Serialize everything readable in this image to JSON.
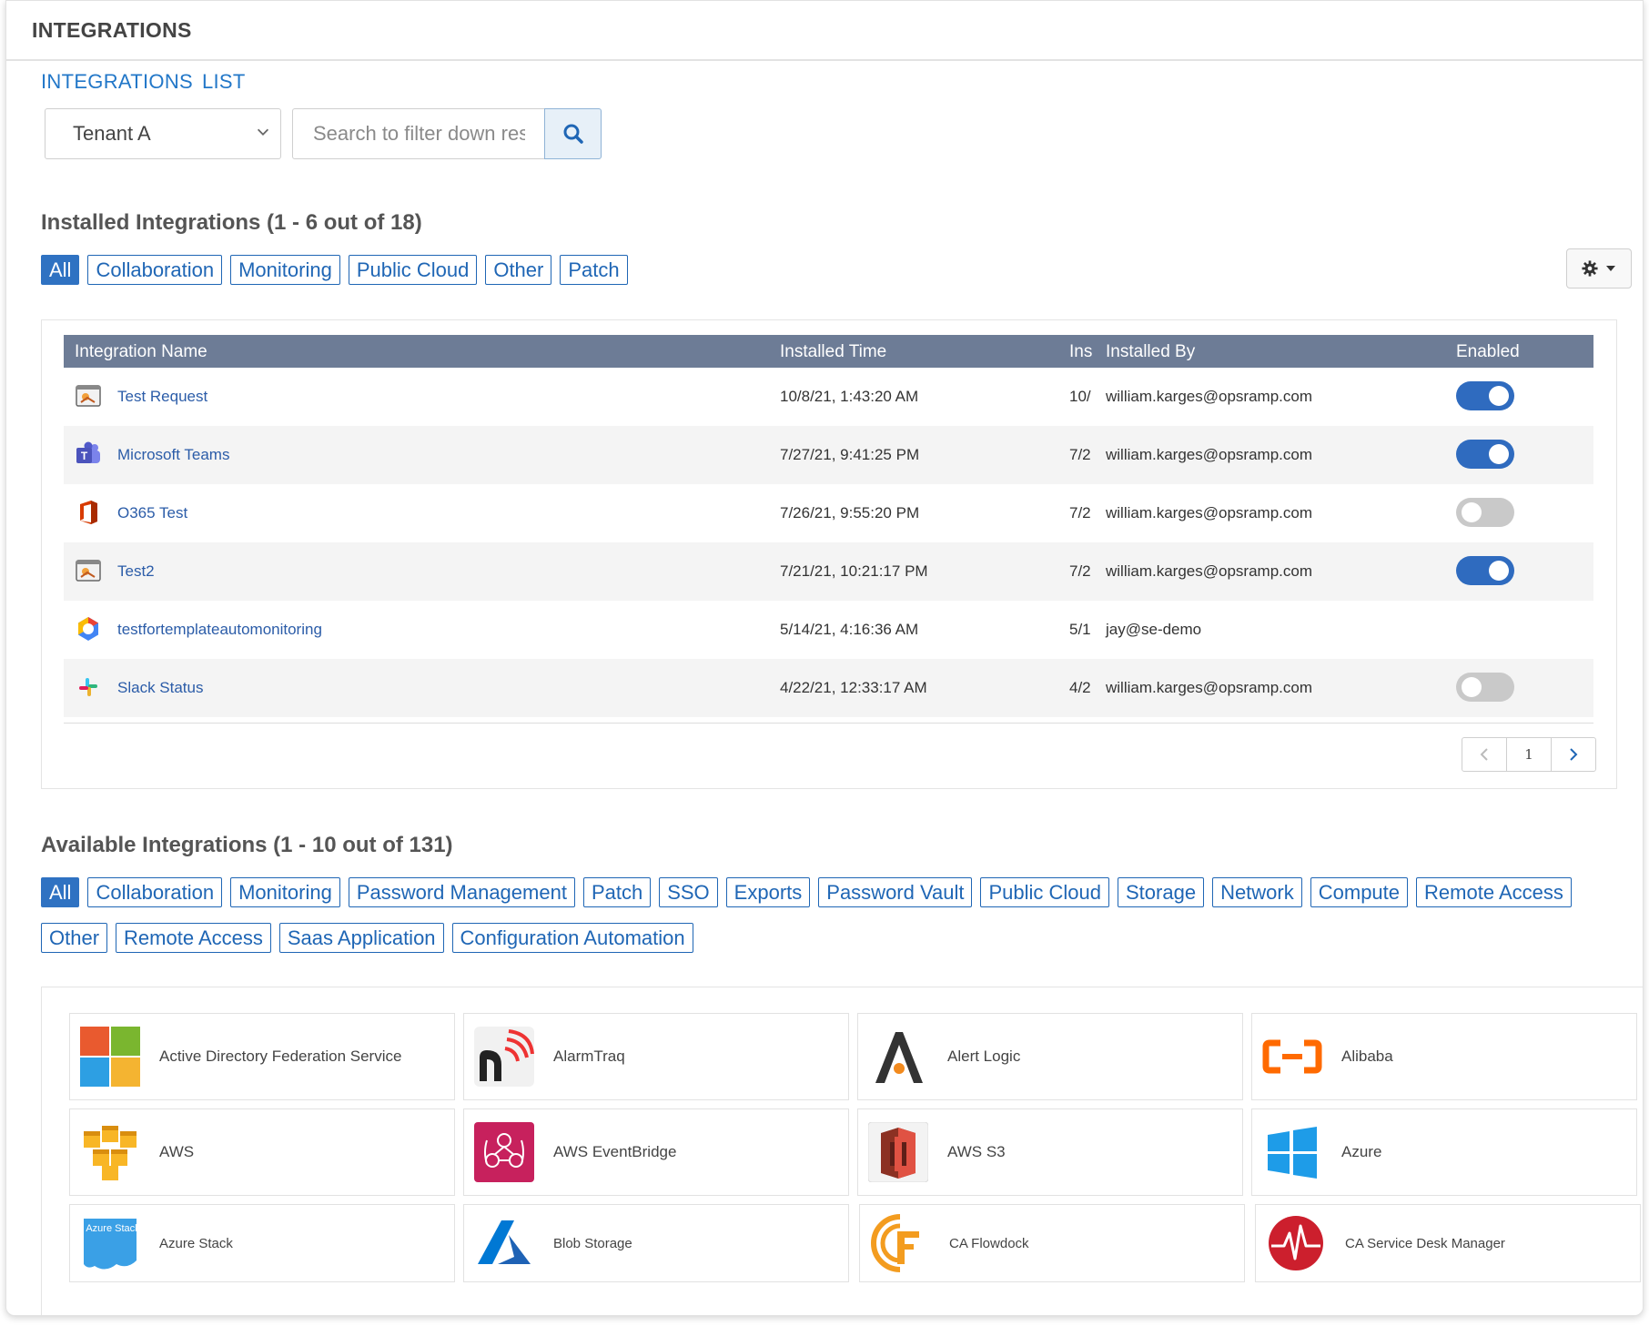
{
  "header": {
    "title": "INTEGRATIONS"
  },
  "breadcrumb": [
    "INTEGRATIONS",
    "LIST"
  ],
  "tenant": {
    "selected": "Tenant A"
  },
  "search": {
    "placeholder": "Search to filter down results"
  },
  "installed": {
    "title": "Installed Integrations (1 - 6 out of 18)",
    "filters": [
      "All",
      "Collaboration",
      "Monitoring",
      "Public Cloud",
      "Other",
      "Patch"
    ],
    "active_filter": "All",
    "columns": {
      "name": "Integration Name",
      "time": "Installed Time",
      "ins": "Ins",
      "by": "Installed By",
      "enabled": "Enabled"
    },
    "rows": [
      {
        "name": "Test Request",
        "icon": "request-icon",
        "time": "10/8/21, 1:43:20 AM",
        "ins": "10/",
        "by": "william.karges@opsramp.com",
        "enabled": "on"
      },
      {
        "name": "Microsoft Teams",
        "icon": "teams-icon",
        "time": "7/27/21, 9:41:25 PM",
        "ins": "7/2",
        "by": "william.karges@opsramp.com",
        "enabled": "on"
      },
      {
        "name": "O365 Test",
        "icon": "office-icon",
        "time": "7/26/21, 9:55:20 PM",
        "ins": "7/2",
        "by": "william.karges@opsramp.com",
        "enabled": "off"
      },
      {
        "name": "Test2",
        "icon": "request-icon",
        "time": "7/21/21, 10:21:17 PM",
        "ins": "7/2",
        "by": "william.karges@opsramp.com",
        "enabled": "on"
      },
      {
        "name": "testfortemplateautomonitoring",
        "icon": "gcp-icon",
        "time": "5/14/21, 4:16:36 AM",
        "ins": "5/1",
        "by": "jay@se-demo",
        "enabled": "none"
      },
      {
        "name": "Slack Status",
        "icon": "slack-icon",
        "time": "4/22/21, 12:33:17 AM",
        "ins": "4/2",
        "by": "william.karges@opsramp.com",
        "enabled": "off"
      }
    ],
    "pager": {
      "prev": "‹",
      "page": "1",
      "next": "›"
    }
  },
  "available": {
    "title": "Available Integrations (1 - 10 out of 131)",
    "filters_row1": [
      "All",
      "Collaboration",
      "Monitoring",
      "Password Management",
      "Patch",
      "SSO",
      "Exports",
      "Password Vault",
      "Public Cloud",
      "Storage",
      "Network",
      "Compute",
      "Remote Access"
    ],
    "filters_row2": [
      "Other",
      "Remote Access",
      "Saas Application",
      "Configuration Automation"
    ],
    "active_filter": "All",
    "cards": [
      {
        "label": "Active Directory Federation Service",
        "icon": "windows-tiles-icon"
      },
      {
        "label": "AlarmTraq",
        "icon": "alarmtraq-icon"
      },
      {
        "label": "Alert Logic",
        "icon": "alert-logic-icon"
      },
      {
        "label": "Alibaba",
        "icon": "alibaba-icon"
      },
      {
        "label": "AWS",
        "icon": "aws-cubes-icon"
      },
      {
        "label": "AWS EventBridge",
        "icon": "eventbridge-icon"
      },
      {
        "label": "AWS S3",
        "icon": "s3-bucket-icon"
      },
      {
        "label": "Azure",
        "icon": "azure-windows-icon"
      },
      {
        "label": "Azure Stack",
        "icon": "azure-stack-icon"
      },
      {
        "label": "Blob Storage",
        "icon": "azure-a-icon"
      },
      {
        "label": "CA Flowdock",
        "icon": "flowdock-icon"
      },
      {
        "label": "CA Service Desk Manager",
        "icon": "ca-heartbeat-icon"
      }
    ],
    "azure_stack_logo_text": "Azure Stack"
  },
  "colors": {
    "accent": "#2f72c2",
    "table_header": "#6d7c96",
    "link": "#2b5ca8"
  }
}
